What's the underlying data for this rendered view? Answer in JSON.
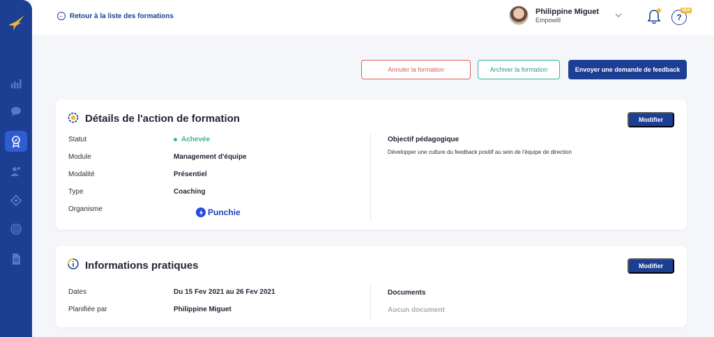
{
  "topbar": {
    "back_label": "Retour à la liste des formations",
    "user_name": "Philippine Miguet",
    "user_org": "Empowill",
    "help_symbol": "?",
    "help_badge": "NEW"
  },
  "actions": {
    "cancel": "Annuler la formation",
    "archive": "Archiver la formation",
    "feedback": "Envoyer une demande de feedback"
  },
  "details": {
    "title": "Détails de l'action de formation",
    "modify": "Modifier",
    "rows": [
      {
        "label": "Statut",
        "value": "Achevée"
      },
      {
        "label": "Module",
        "value": "Management d'équipe"
      },
      {
        "label": "Modalité",
        "value": "Présentiel"
      },
      {
        "label": "Type",
        "value": "Coaching"
      },
      {
        "label": "Organisme",
        "value": "Punchie"
      }
    ],
    "objective_title": "Objectif pédagogique",
    "objective_text": "Développer une culture du feedback positif au sein de l'équipe de direction"
  },
  "practical": {
    "title": "Informations pratiques",
    "modify": "Modifier",
    "rows": [
      {
        "label": "Dates",
        "value": "Du 15 Fev 2021 au 26 Fev 2021"
      },
      {
        "label": "Planifiée par",
        "value": "Philippine Miguet"
      }
    ],
    "documents_title": "Documents",
    "documents_empty": "Aucun document"
  },
  "colors": {
    "brand": "#1d3f93",
    "danger": "#e55a5a",
    "success": "#3bb58f",
    "teal": "#33b3a0",
    "accent": "#f5b82e"
  },
  "sidebar": {
    "icons": [
      "logo-bird-icon",
      "stats-icon",
      "chat-icon",
      "training-badge-icon",
      "people-icon",
      "network-icon",
      "target-icon",
      "document-icon"
    ]
  }
}
